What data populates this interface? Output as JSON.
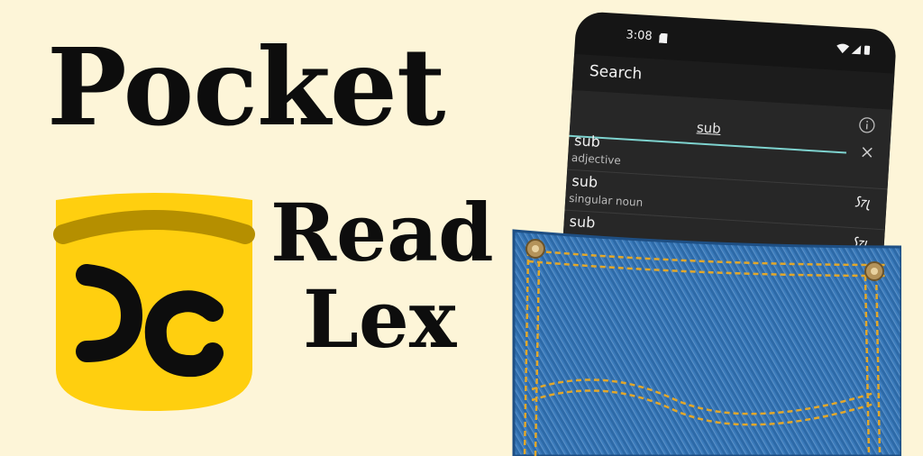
{
  "brand": {
    "title_line1": "Pocket",
    "title_line2": "Read",
    "title_line3": "Lex"
  },
  "colors": {
    "background": "#fdf5d8",
    "logo_yellow": "#ffcf0f",
    "logo_band": "#b58f00",
    "accent_line": "#7ed3cf",
    "denim": "#2d6aa8",
    "stitch": "#e2a72a"
  },
  "phone": {
    "status": {
      "time": "3:08",
      "icons": [
        "sd-card-icon",
        "wifi-icon",
        "signal-icon",
        "battery-icon"
      ]
    },
    "app_bar": {
      "title": "Search"
    },
    "search": {
      "value": "sub"
    },
    "results": [
      {
        "word": "sub",
        "pos": "adjective",
        "shavian": ""
      },
      {
        "word": "sub",
        "pos": "singular noun",
        "shavian": "𐑕𐑳𐑚"
      },
      {
        "word": "sub",
        "pos": "",
        "shavian": "𐑕𐑳𐑚"
      }
    ]
  }
}
